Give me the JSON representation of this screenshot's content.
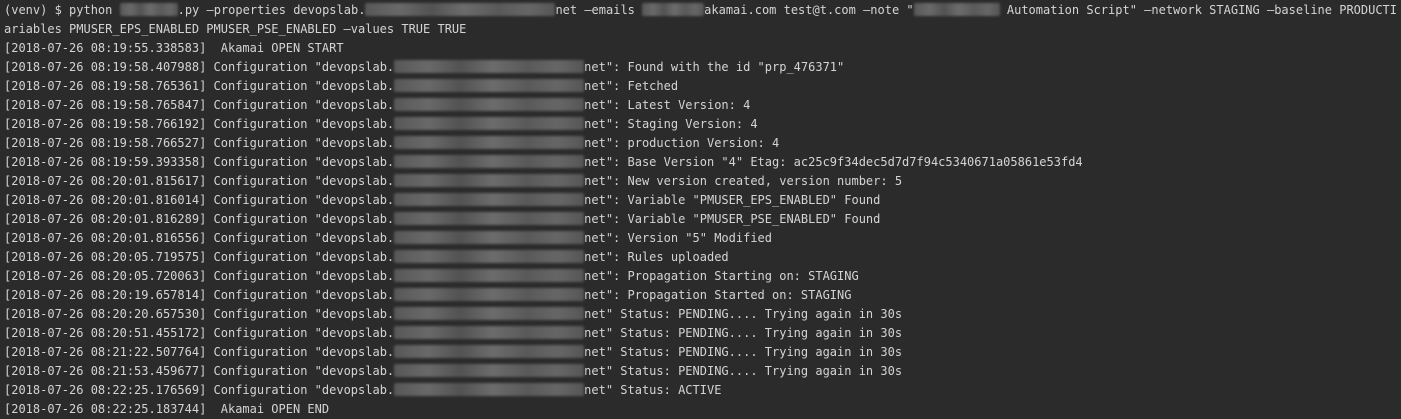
{
  "terminal": {
    "command_line_1": {
      "prefix": "(venv) $ python ",
      "after_script": ".py –properties devopslab.",
      "after_domain": "net –emails ",
      "after_email": "akamai.com test@t.com –note \"",
      "after_note": " Automation Script\" –network STAGING –baseline PRODUCTION –v"
    },
    "command_line_2": "ariables PMUSER_EPS_ENABLED PMUSER_PSE_ENABLED –values TRUE TRUE",
    "log_start": "[2018-07-26 08:19:55.338583]  Akamai OPEN START",
    "config_prefix": "Configuration \"devopslab.",
    "entries": [
      {
        "ts": "[2018-07-26 08:19:58.407988]",
        "msg": "net\": Found with the id \"prp_476371\""
      },
      {
        "ts": "[2018-07-26 08:19:58.765361]",
        "msg": "net\": Fetched"
      },
      {
        "ts": "[2018-07-26 08:19:58.765847]",
        "msg": "net\": Latest Version: 4"
      },
      {
        "ts": "[2018-07-26 08:19:58.766192]",
        "msg": "net\": Staging Version: 4"
      },
      {
        "ts": "[2018-07-26 08:19:58.766527]",
        "msg": "net\": production Version: 4"
      },
      {
        "ts": "[2018-07-26 08:19:59.393358]",
        "msg": "net\": Base Version \"4\" Etag: ac25c9f34dec5d7d7f94c5340671a05861e53fd4"
      },
      {
        "ts": "[2018-07-26 08:20:01.815617]",
        "msg": "net\": New version created, version number: 5"
      },
      {
        "ts": "[2018-07-26 08:20:01.816014]",
        "msg": "net\": Variable \"PMUSER_EPS_ENABLED\" Found"
      },
      {
        "ts": "[2018-07-26 08:20:01.816289]",
        "msg": "net\": Variable \"PMUSER_PSE_ENABLED\" Found"
      },
      {
        "ts": "[2018-07-26 08:20:01.816556]",
        "msg": "net\": Version \"5\" Modified"
      },
      {
        "ts": "[2018-07-26 08:20:05.719575]",
        "msg": "net\": Rules uploaded"
      },
      {
        "ts": "[2018-07-26 08:20:05.720063]",
        "msg": "net\": Propagation Starting on: STAGING"
      },
      {
        "ts": "[2018-07-26 08:20:19.657814]",
        "msg": "net\": Propagation Started on: STAGING"
      },
      {
        "ts": "[2018-07-26 08:20:20.657530]",
        "msg": "net\" Status: PENDING.... Trying again in 30s"
      },
      {
        "ts": "[2018-07-26 08:20:51.455172]",
        "msg": "net\" Status: PENDING.... Trying again in 30s"
      },
      {
        "ts": "[2018-07-26 08:21:22.507764]",
        "msg": "net\" Status: PENDING.... Trying again in 30s"
      },
      {
        "ts": "[2018-07-26 08:21:53.459677]",
        "msg": "net\" Status: PENDING.... Trying again in 30s"
      },
      {
        "ts": "[2018-07-26 08:22:25.176569]",
        "msg": "net\" Status: ACTIVE"
      }
    ],
    "log_end": "[2018-07-26 08:22:25.183744]  Akamai OPEN END"
  }
}
